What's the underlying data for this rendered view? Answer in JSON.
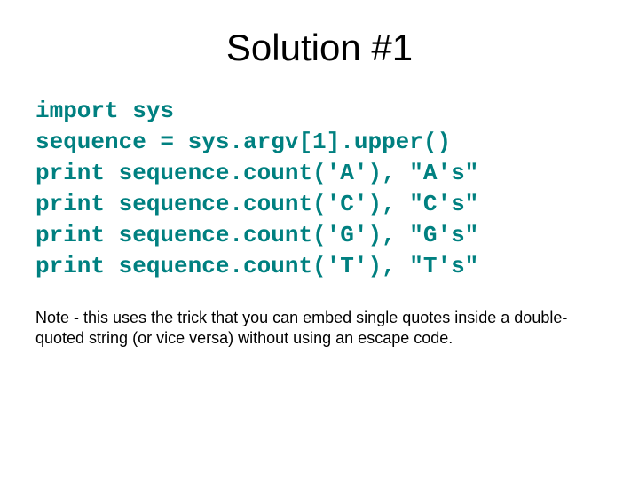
{
  "title": "Solution #1",
  "code": {
    "line1": "import sys",
    "line2": "sequence = sys.argv[1].upper()",
    "line3": "print sequence.count('A'), \"A's\"",
    "line4": "print sequence.count('C'), \"C's\"",
    "line5": "print sequence.count('G'), \"G's\"",
    "line6": "print sequence.count('T'), \"T's\""
  },
  "note": "Note - this uses the trick that you can embed single quotes inside a double-quoted string (or vice versa) without using an escape code."
}
